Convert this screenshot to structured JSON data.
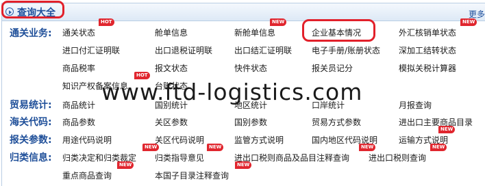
{
  "header": {
    "title": "查询大全",
    "more": "更多"
  },
  "watermark": "www.ftd-logistics.com",
  "categories": [
    {
      "label": "通关业务:"
    },
    {
      "label": "贸易统计:"
    },
    {
      "label": "海关代码:"
    },
    {
      "label": "报关参数:"
    },
    {
      "label": "归类信息:"
    }
  ],
  "items": {
    "customs": [
      "通关状态",
      "舱单信息",
      "新舱单信息",
      "企业基本情况",
      "外汇核销单状态",
      "进口付汇证明联",
      "出口退税证明联",
      "出口结汇证明联",
      "电子手册/账册状态",
      "深加工结转状态",
      "商品税率",
      "报文状态",
      "快件状态",
      "报关员记分",
      "模拟关税计算器",
      "知识产权备案信息",
      "台账状态"
    ],
    "trade": [
      "商品统计",
      "国别统计",
      "地区统计",
      "口岸统计",
      "月报查询"
    ],
    "codes": [
      "商品参数",
      "关区参数",
      "国别参数",
      "贸易方式参数",
      "进出口主要商品目录"
    ],
    "params": [
      "用途代码说明",
      "关区代码说明",
      "监管方式说明",
      "国内地区代码说明",
      "运输方式说明"
    ],
    "classify": [
      "归类决定和归类裁定",
      "归类指导意见",
      "进出口税则商品及品目注释查询",
      "进出口税则查询",
      "重点商品查询",
      "本国子目录注释查询"
    ]
  },
  "badges": {
    "hot": "HOT",
    "new": "NEW"
  },
  "colors": {
    "accent_red": "#e2202a",
    "brand_blue": "#1e4f9c",
    "badge_red": "#e0262e"
  }
}
